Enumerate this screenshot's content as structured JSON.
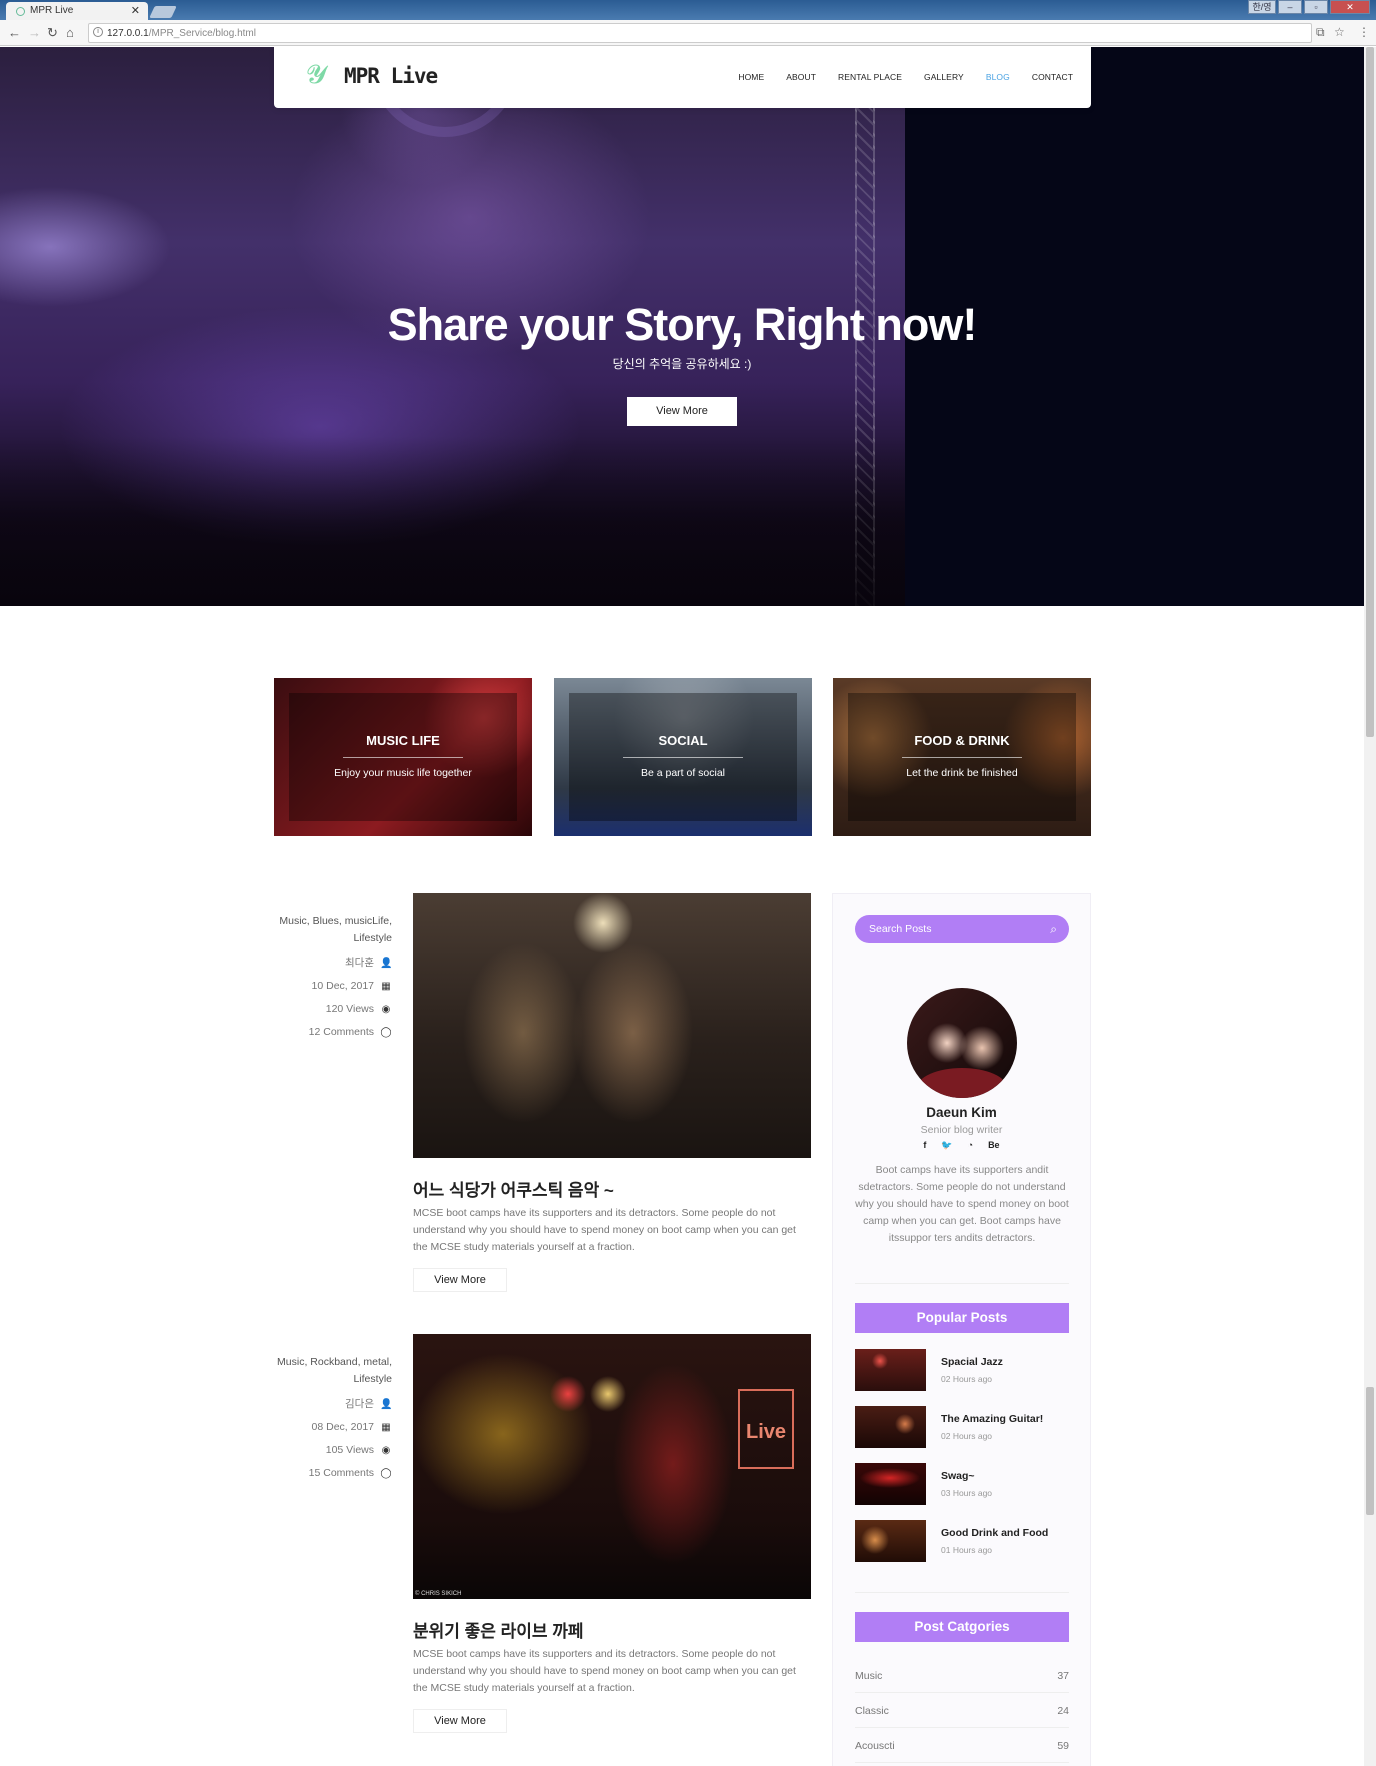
{
  "browser": {
    "tab_title": "MPR Live",
    "url_host": "127.0.0.1",
    "url_path": "/MPR_Service/blog.html",
    "keyboard_btn": "한/영"
  },
  "nav": {
    "logo": "MPR Live",
    "items": [
      "HOME",
      "ABOUT",
      "RENTAL PLACE",
      "GALLERY",
      "BLOG",
      "CONTACT"
    ],
    "active": "BLOG"
  },
  "hero": {
    "title": "Share your Story, Right now!",
    "subtitle": "당신의 추억을 공유하세요 :)",
    "button": "View More"
  },
  "categories": [
    {
      "title": "MUSIC LIFE",
      "text": "Enjoy your music life together"
    },
    {
      "title": "SOCIAL",
      "text": "Be a part of social"
    },
    {
      "title": "FOOD & DRINK",
      "text": "Let the drink be finished"
    }
  ],
  "posts": [
    {
      "tags": "Music, Blues, musicLife, Lifestyle",
      "author": "최다훈",
      "date": "10 Dec, 2017",
      "views": "120 Views",
      "comments": "12 Comments",
      "title": "어느 식당가 어쿠스틱 음악 ~",
      "excerpt": "MCSE boot camps have its supporters and its detractors. Some people do not understand why you should have to spend money on boot camp when you can get the MCSE study materials yourself at a fraction.",
      "button": "View More"
    },
    {
      "tags": "Music, Rockband, metal, Lifestyle",
      "author": "김다은",
      "date": "08 Dec, 2017",
      "views": "105 Views",
      "comments": "15 Comments",
      "title": "분위기 좋은 라이브 까페",
      "excerpt": "MCSE boot camps have its supporters and its detractors. Some people do not understand why you should have to spend money on boot camp when you can get the MCSE study materials yourself at a fraction.",
      "button": "View More",
      "sign_text": "Live",
      "credit": "© CHRIS SIKICH"
    }
  ],
  "sidebar": {
    "search_placeholder": "Search Posts",
    "author": {
      "name": "Daeun Kim",
      "role": "Senior blog writer",
      "social": [
        "f",
        "t",
        "gh",
        "Be"
      ],
      "bio": "Boot camps have its supporters andit sdetractors. Some people do not understand why you should have to spend money on boot camp when you can get. Boot camps have itssuppor ters andits detractors."
    },
    "popular_title": "Popular Posts",
    "popular": [
      {
        "title": "Spacial Jazz",
        "time": "02 Hours ago"
      },
      {
        "title": "The Amazing Guitar!",
        "time": "02 Hours ago"
      },
      {
        "title": "Swag~",
        "time": "03 Hours ago"
      },
      {
        "title": "Good Drink and Food",
        "time": "01 Hours ago"
      }
    ],
    "categories_title": "Post Catgories",
    "categories": [
      {
        "name": "Music",
        "count": "37"
      },
      {
        "name": "Classic",
        "count": "24"
      },
      {
        "name": "Acouscti",
        "count": "59"
      }
    ]
  },
  "colors": {
    "accent": "#b17ef5",
    "nav_active": "#4ba3e3"
  },
  "icons": {
    "author": "user-icon",
    "date": "calendar-icon",
    "views": "eye-icon",
    "comments": "comment-icon"
  }
}
